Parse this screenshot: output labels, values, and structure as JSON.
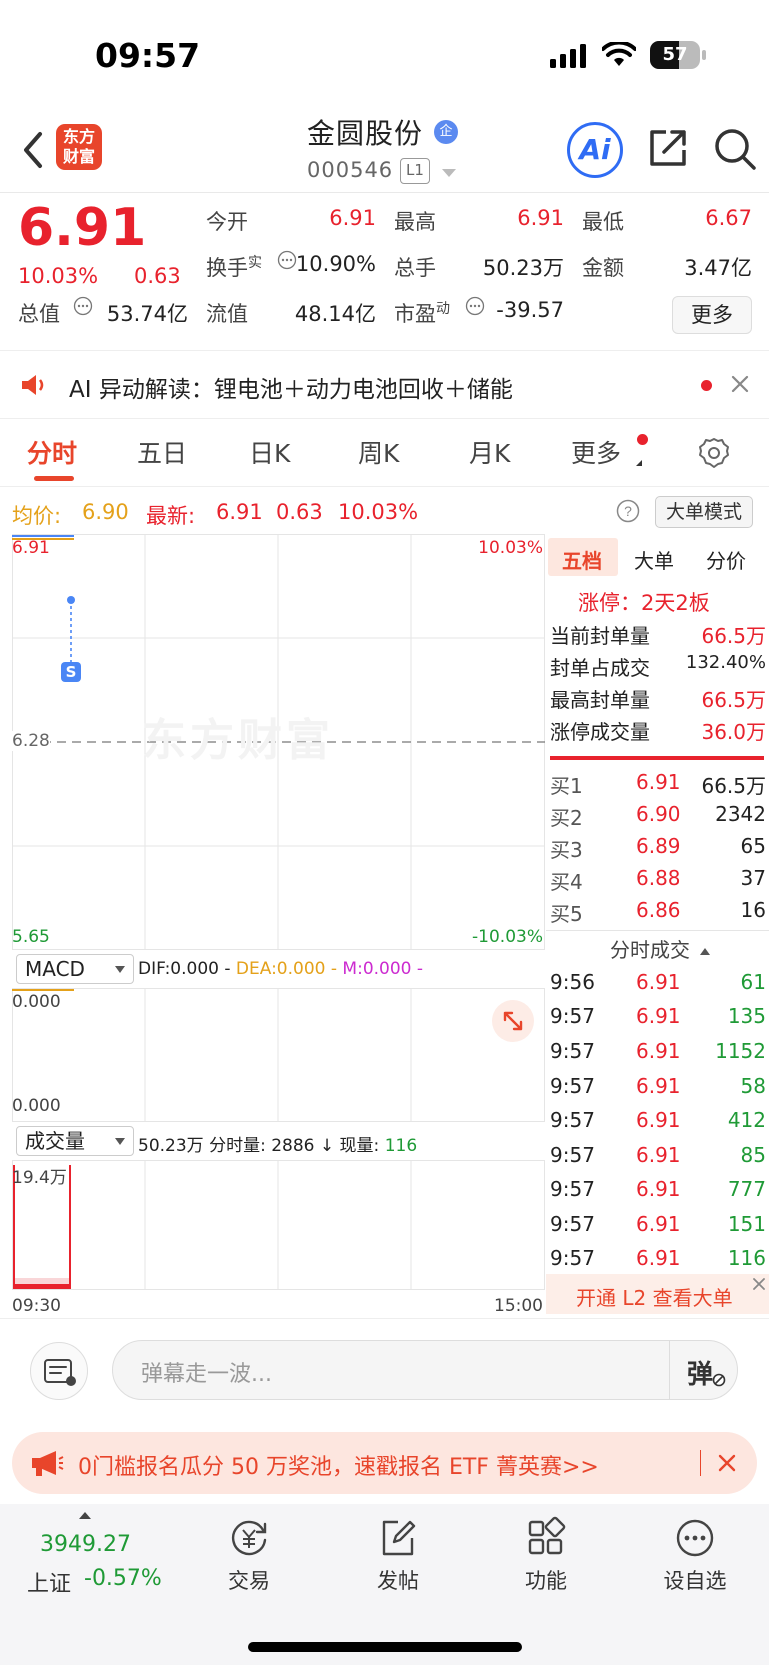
{
  "status": {
    "time": "09:57",
    "battery": "57"
  },
  "header": {
    "logo_line1": "东方",
    "logo_line2": "财富",
    "stock_name": "金圆股份",
    "badge": "企",
    "stock_code": "000546",
    "level": "L1",
    "ai_label": "Ai"
  },
  "quote": {
    "price": "6.91",
    "change_pct": "10.03%",
    "change": "0.63",
    "fields": [
      {
        "label": "今开",
        "value": "6.91",
        "color": "red"
      },
      {
        "label": "最高",
        "value": "6.91",
        "color": "red"
      },
      {
        "label": "最低",
        "value": "6.67",
        "color": "red"
      },
      {
        "label": "换手",
        "sup": "实",
        "value": "10.90%",
        "color": "black"
      },
      {
        "label": "总手",
        "value": "50.23万",
        "color": "black"
      },
      {
        "label": "金额",
        "value": "3.47亿",
        "color": "black"
      },
      {
        "label": "总值",
        "value": "53.74亿",
        "color": "black"
      },
      {
        "label": "流值",
        "value": "48.14亿",
        "color": "black"
      },
      {
        "label": "市盈",
        "sup": "动",
        "value": "-39.57",
        "color": "black"
      }
    ],
    "more_label": "更多"
  },
  "ai_bar": {
    "text": "AI 异动解读：锂电池＋动力电池回收＋储能"
  },
  "tabs": [
    "分时",
    "五日",
    "日K",
    "周K",
    "月K",
    "更多"
  ],
  "avg_bar": {
    "avg_label": "均价:",
    "avg_value": "6.90",
    "last_label": "最新:",
    "last_value": "6.91",
    "change": "0.63",
    "pct": "10.03%",
    "big_mode": "大单模式"
  },
  "chart_data": {
    "type": "line",
    "price_axis": {
      "top": "6.91",
      "mid": "6.28",
      "bottom": "5.65"
    },
    "pct_axis": {
      "top": "10.03%",
      "bottom": "-10.03%"
    },
    "time_axis": {
      "start": "09:30",
      "end": "15:00"
    },
    "watermark": "东方财富",
    "marker": "S"
  },
  "macd": {
    "selector": "MACD",
    "dif": "DIF:0.000 -",
    "dea": "DEA:0.000 -",
    "m": "M:0.000 -",
    "top": "0.000",
    "bottom": "0.000"
  },
  "volume": {
    "selector": "成交量",
    "total": "50.23万",
    "period_label": "分时量:",
    "period_value": "2886",
    "arrow": "↓",
    "now_label": "现量:",
    "now_value": "116",
    "max_label": "19.4万"
  },
  "right_panel": {
    "tabs": [
      "五档",
      "大单",
      "分价"
    ],
    "limit_up": "涨停：2天2板",
    "stats": [
      {
        "label": "当前封单量",
        "value": "66.5万",
        "color": "red"
      },
      {
        "label": "封单占成交",
        "value": "132.40%",
        "color": "black"
      },
      {
        "label": "最高封单量",
        "value": "66.5万",
        "color": "red"
      },
      {
        "label": "涨停成交量",
        "value": "36.0万",
        "color": "red"
      }
    ],
    "bids": [
      {
        "label": "买1",
        "price": "6.91",
        "vol": "66.5万"
      },
      {
        "label": "买2",
        "price": "6.90",
        "vol": "2342"
      },
      {
        "label": "买3",
        "price": "6.89",
        "vol": "65"
      },
      {
        "label": "买4",
        "price": "6.88",
        "vol": "37"
      },
      {
        "label": "买5",
        "price": "6.86",
        "vol": "16"
      }
    ],
    "trades_title": "分时成交",
    "trades": [
      {
        "time": "9:56",
        "price": "6.91",
        "vol": "61"
      },
      {
        "time": "9:57",
        "price": "6.91",
        "vol": "135"
      },
      {
        "time": "9:57",
        "price": "6.91",
        "vol": "1152"
      },
      {
        "time": "9:57",
        "price": "6.91",
        "vol": "58"
      },
      {
        "time": "9:57",
        "price": "6.91",
        "vol": "412"
      },
      {
        "time": "9:57",
        "price": "6.91",
        "vol": "85"
      },
      {
        "time": "9:57",
        "price": "6.91",
        "vol": "777"
      },
      {
        "time": "9:57",
        "price": "6.91",
        "vol": "151"
      },
      {
        "time": "9:57",
        "price": "6.91",
        "vol": "116"
      }
    ],
    "l2_cta": "开通 L2 查看大单"
  },
  "danmu": {
    "placeholder": "弹幕走一波...",
    "button": "弹"
  },
  "banner": {
    "text": "0门槛报名瓜分 50 万奖池，速戳报名 ETF 菁英赛>>"
  },
  "nav": {
    "index_value": "3949.27",
    "index_name": "上证",
    "index_pct": "-0.57%",
    "items": [
      "交易",
      "发帖",
      "功能",
      "设自选"
    ]
  }
}
